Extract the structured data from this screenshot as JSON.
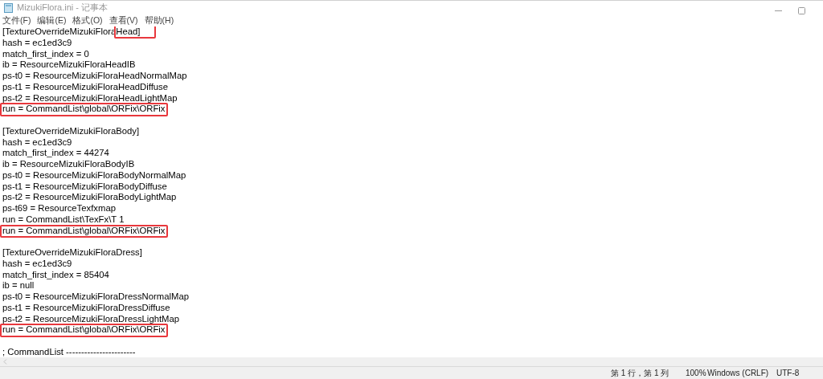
{
  "window": {
    "title": "MizukiFlora.ini - 记事本"
  },
  "menu": [
    "文件(F)",
    "编辑(E)",
    "格式(O)",
    "查看(V)",
    "帮助(H)"
  ],
  "editor": {
    "lines": [
      {
        "kind": "text",
        "segments": [
          {
            "text": "[TextureOverrideMizukiFlora",
            "highlighted": false
          },
          {
            "text": "Head]",
            "highlighted": true
          }
        ]
      },
      {
        "kind": "text",
        "segments": [
          {
            "text": "hash = ec1ed3c9",
            "highlighted": false
          }
        ]
      },
      {
        "kind": "text",
        "segments": [
          {
            "text": "match_first_index = 0",
            "highlighted": false
          }
        ]
      },
      {
        "kind": "text",
        "segments": [
          {
            "text": "ib = ResourceMizukiFloraHeadIB",
            "highlighted": false
          }
        ]
      },
      {
        "kind": "text",
        "segments": [
          {
            "text": "ps-t0 = ResourceMizukiFloraHeadNormalMap",
            "highlighted": false
          }
        ]
      },
      {
        "kind": "text",
        "segments": [
          {
            "text": "ps-t1 = ResourceMizukiFloraHeadDiffuse",
            "highlighted": false
          }
        ]
      },
      {
        "kind": "text",
        "segments": [
          {
            "text": "ps-t2 = ResourceMizukiFloraHeadLightMap",
            "highlighted": false
          }
        ]
      },
      {
        "kind": "text",
        "segments": [
          {
            "text": "run = CommandList\\global\\ORFix\\ORFix",
            "highlighted": true
          }
        ]
      },
      {
        "kind": "blank"
      },
      {
        "kind": "text",
        "segments": [
          {
            "text": "[TextureOverrideMizukiFloraBody]",
            "highlighted": false
          }
        ]
      },
      {
        "kind": "text",
        "segments": [
          {
            "text": "hash = ec1ed3c9",
            "highlighted": false
          }
        ]
      },
      {
        "kind": "text",
        "segments": [
          {
            "text": "match_first_index = 44274",
            "highlighted": false
          }
        ]
      },
      {
        "kind": "text",
        "segments": [
          {
            "text": "ib = ResourceMizukiFloraBodyIB",
            "highlighted": false
          }
        ]
      },
      {
        "kind": "text",
        "segments": [
          {
            "text": "ps-t0 = ResourceMizukiFloraBodyNormalMap",
            "highlighted": false
          }
        ]
      },
      {
        "kind": "text",
        "segments": [
          {
            "text": "ps-t1 = ResourceMizukiFloraBodyDiffuse",
            "highlighted": false
          }
        ]
      },
      {
        "kind": "text",
        "segments": [
          {
            "text": "ps-t2 = ResourceMizukiFloraBodyLightMap",
            "highlighted": false
          }
        ]
      },
      {
        "kind": "text",
        "segments": [
          {
            "text": "ps-t69 = ResourceTexfxmap",
            "highlighted": false
          }
        ]
      },
      {
        "kind": "text",
        "segments": [
          {
            "text": "run = CommandList\\TexFx\\T 1",
            "highlighted": false
          }
        ]
      },
      {
        "kind": "text",
        "segments": [
          {
            "text": "run = CommandList\\global\\ORFix\\ORFix",
            "highlighted": true
          }
        ]
      },
      {
        "kind": "blank"
      },
      {
        "kind": "text",
        "segments": [
          {
            "text": "[TextureOverrideMizukiFloraDress]",
            "highlighted": false
          }
        ]
      },
      {
        "kind": "text",
        "segments": [
          {
            "text": "hash = ec1ed3c9",
            "highlighted": false
          }
        ]
      },
      {
        "kind": "text",
        "segments": [
          {
            "text": "match_first_index = 85404",
            "highlighted": false
          }
        ]
      },
      {
        "kind": "text",
        "segments": [
          {
            "text": "ib = null",
            "highlighted": false
          }
        ]
      },
      {
        "kind": "text",
        "segments": [
          {
            "text": "ps-t0 = ResourceMizukiFloraDressNormalMap",
            "highlighted": false
          }
        ]
      },
      {
        "kind": "text",
        "segments": [
          {
            "text": "ps-t1 = ResourceMizukiFloraDressDiffuse",
            "highlighted": false
          }
        ]
      },
      {
        "kind": "text",
        "segments": [
          {
            "text": "ps-t2 = ResourceMizukiFloraDressLightMap",
            "highlighted": false
          }
        ]
      },
      {
        "kind": "text",
        "segments": [
          {
            "text": "run = CommandList\\global\\ORFix\\ORFix",
            "highlighted": true
          }
        ]
      },
      {
        "kind": "blank"
      },
      {
        "kind": "text",
        "segments": [
          {
            "text": "; CommandList -----------------------",
            "highlighted": false
          }
        ]
      }
    ]
  },
  "status_bar": [
    "第 1 行，第 1 列",
    "100%",
    "Windows (CRLF)",
    "UTF-8"
  ]
}
